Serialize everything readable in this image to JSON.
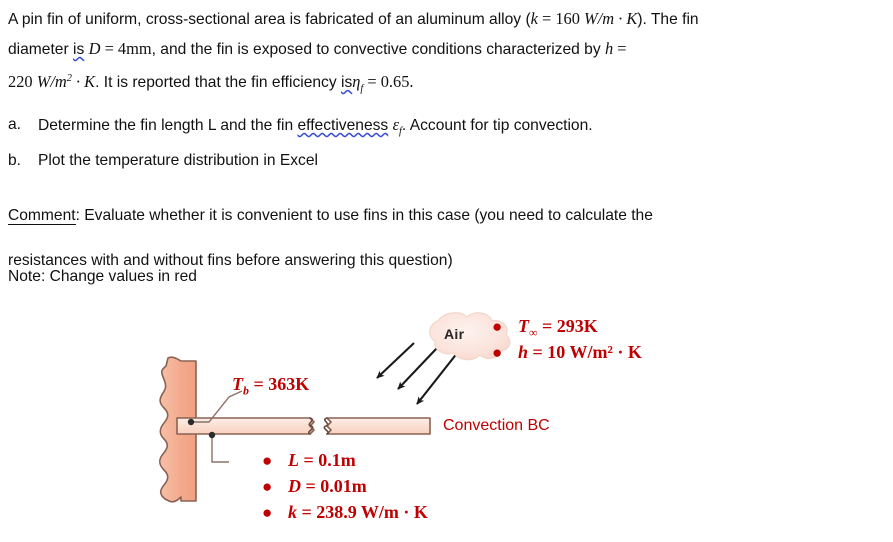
{
  "document": {
    "statement": {
      "line1_a": "A pin fin of uniform, cross-sectional area is fabricated of an aluminum alloy (",
      "line1_k": "k",
      "line1_eq": " = 160 ",
      "line1_units": "W/m · K",
      "line1_b": ").  The fin",
      "line2_a": "diameter ",
      "line2_is": "is",
      "line2_sp": " ",
      "line2_D": "D",
      "line2_eq": " = 4mm",
      "line2_b": ", and the fin is exposed to convective conditions characterized by ",
      "line2_h": "h",
      "line2_c": " =",
      "line3_val": "220 ",
      "line3_units": "W/m",
      "line3_exp": "2",
      "line3_units2": " · K",
      "line3_a": ". It is reported that the fin efficiency ",
      "line3_is": "is",
      "line3_eta": "η",
      "line3_eta_sub": "f",
      "line3_b": " = 0.65."
    },
    "tasks": [
      {
        "marker": "a.",
        "text_a": "Determine the fin length L and the fin ",
        "underlined": "effectiveness",
        "sym": "ε",
        "sym_sub": "f",
        "text_b": ". Account for tip convection."
      },
      {
        "marker": "b.",
        "text_a": "Plot the temperature distribution in Excel",
        "underlined": "",
        "sym": "",
        "sym_sub": "",
        "text_b": ""
      }
    ],
    "comment": {
      "label": "Comment",
      "colon": ":  ",
      "body_line1": "Evaluate whether it is convenient to use fins in this case (you need to calculate the",
      "body_line2": "resistances with and without fins before answering this question)"
    },
    "note": "Note:  Change values in red"
  },
  "figure": {
    "air_label": "Air",
    "convection_bc_label": "Convection BC",
    "base_temp": {
      "sym": "T",
      "sub": "b",
      "value": " = 363K"
    },
    "air_conditions": [
      {
        "sym": "T",
        "sub": "∞",
        "sup": "",
        "value": " = 293K"
      },
      {
        "sym": "h",
        "sub": "",
        "sup": "",
        "value": " = 10 W/m² · K"
      }
    ],
    "fin_properties": [
      {
        "sym": "L",
        "value": " = 0.1m"
      },
      {
        "sym": "D",
        "value": " = 0.01m"
      },
      {
        "sym": "k",
        "value": " = 238.9 W/m · K"
      }
    ],
    "bullet_glyph": "●",
    "colors": {
      "red": "#c00000",
      "wall_fill": "#f4b094",
      "fin_fill": "#fbe2d5",
      "outline": "#7f6050",
      "arrow": "#1a1a1a",
      "squiggle": "#3a4fd6"
    }
  }
}
